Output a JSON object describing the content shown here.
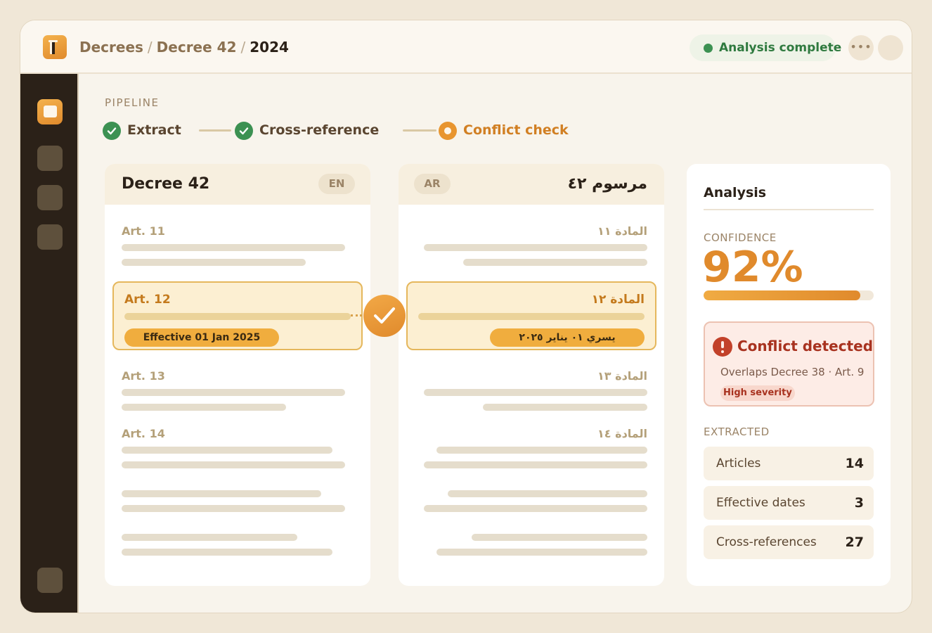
{
  "header": {
    "breadcrumb": [
      "Decrees",
      "Decree 42",
      "2024"
    ],
    "status": "Analysis complete"
  },
  "pipeline": {
    "label": "PIPELINE",
    "steps": [
      {
        "label": "Extract",
        "state": "done"
      },
      {
        "label": "Cross-reference",
        "state": "done"
      },
      {
        "label": "Conflict check",
        "state": "active"
      }
    ]
  },
  "doc_en": {
    "title": "Decree 42",
    "lang": "EN",
    "articles": [
      "Art. 11",
      "Art. 12",
      "Art. 13",
      "Art. 14"
    ],
    "highlight_date": "Effective 01 Jan 2025"
  },
  "doc_ar": {
    "title": "مرسوم ٤٢",
    "lang": "AR",
    "articles": [
      "المادة ١١",
      "المادة ١٢",
      "المادة ١٣",
      "المادة ١٤"
    ],
    "highlight_date": "يسري ٠١ يناير ٢٠٢٥"
  },
  "analysis": {
    "title": "Analysis",
    "confidence_label": "CONFIDENCE",
    "confidence_value": "92%",
    "confidence_fraction": 0.92,
    "conflict": {
      "title": "Conflict detected",
      "description": "Overlaps Decree 38 · Art. 9",
      "severity": "High severity"
    },
    "extracted_label": "EXTRACTED",
    "extracted": [
      {
        "name": "Articles",
        "count": "14"
      },
      {
        "name": "Effective dates",
        "count": "3"
      },
      {
        "name": "Cross-references",
        "count": "27"
      }
    ]
  },
  "colors": {
    "accent": "#e08a2c",
    "success": "#3c9152",
    "danger": "#a8321f",
    "sidebar": "#2b2118"
  }
}
